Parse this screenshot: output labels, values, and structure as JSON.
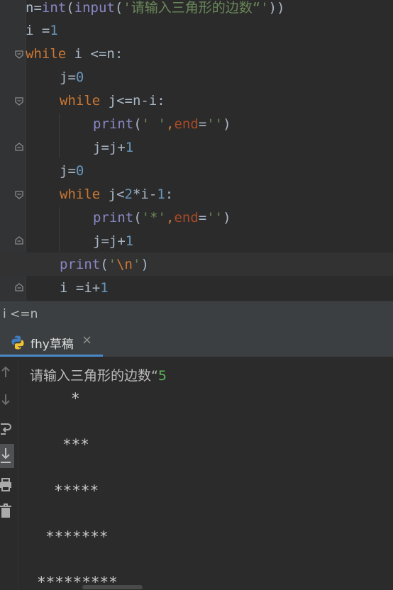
{
  "editor": {
    "lines": [
      {
        "code": "n=int(input('请输入三角形的边数“'))"
      },
      {
        "code": "i =1"
      },
      {
        "code": "while i <=n:"
      },
      {
        "code": "j=0"
      },
      {
        "code": "while j<=n-i:"
      },
      {
        "code": "print(' ',end='')"
      },
      {
        "code": "j=j+1"
      },
      {
        "code": "j=0"
      },
      {
        "code": "while j<2*i-1:"
      },
      {
        "code": "print('*',end='')"
      },
      {
        "code": "j=j+1"
      },
      {
        "code": "print('\\n')"
      },
      {
        "code": "i =i+1"
      }
    ],
    "colors": {
      "keyword": "#cc7832",
      "number": "#6897bb",
      "string": "#6a8759",
      "builtin": "#8888c6",
      "param": "#aa4926"
    }
  },
  "breadcrumb": {
    "text": "i <=n"
  },
  "run": {
    "tab_label": "fhy草稿",
    "tab_icon": "python-icon",
    "close_glyph": "×",
    "tools": [
      "arrow-up-icon",
      "arrow-down-icon",
      "soft-wrap-icon",
      "scroll-to-end-icon",
      "print-icon",
      "trash-icon"
    ]
  },
  "console": {
    "prompt": "请输入三角形的边数“",
    "input_value": "5",
    "star_rows": [
      "*",
      "***",
      "*****",
      "*******",
      "*********"
    ]
  }
}
